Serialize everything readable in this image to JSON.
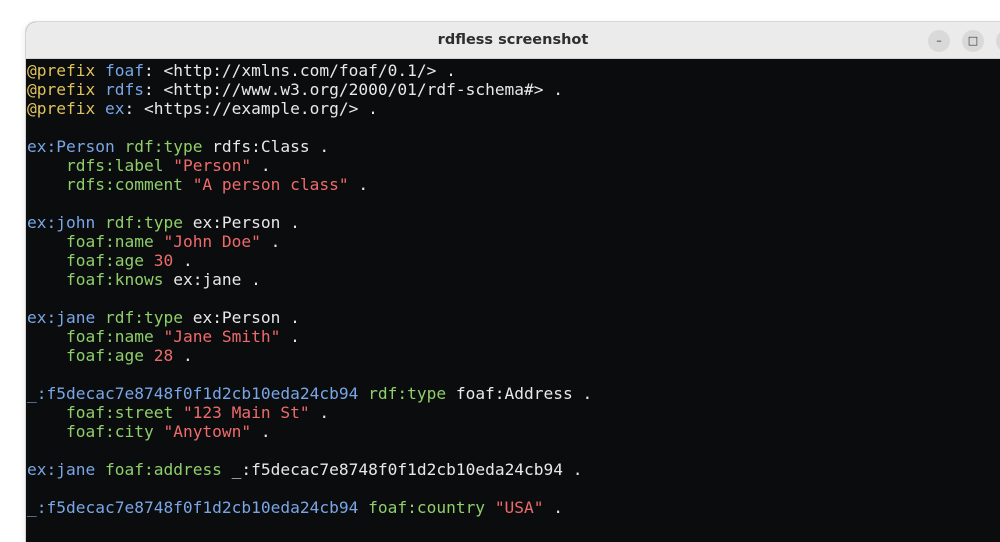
{
  "window": {
    "title": "rdfless screenshot",
    "minimize_symbol": "–",
    "maximize_symbol": "□",
    "close_symbol": "×"
  },
  "colors": {
    "prefix_keyword": "#e0c35c",
    "subject": "#79a6e6",
    "predicate": "#8fcf6a",
    "literal": "#ef6b6b",
    "plain": "#e8e8e8",
    "background": "#0b0c0e"
  },
  "lines": [
    [
      {
        "t": "@prefix",
        "c": "prefix"
      },
      {
        "t": " foaf",
        "c": "ns"
      },
      {
        "t": ": <http://xmlns.com/foaf/0.1/> .",
        "c": "plain"
      }
    ],
    [
      {
        "t": "@prefix",
        "c": "prefix"
      },
      {
        "t": " rdfs",
        "c": "ns"
      },
      {
        "t": ": <http://www.w3.org/2000/01/rdf-schema#> .",
        "c": "plain"
      }
    ],
    [
      {
        "t": "@prefix",
        "c": "prefix"
      },
      {
        "t": " ex",
        "c": "ns"
      },
      {
        "t": ": <https://example.org/> .",
        "c": "plain"
      }
    ],
    [],
    [
      {
        "t": "ex:Person",
        "c": "ns"
      },
      {
        "t": " ",
        "c": "plain"
      },
      {
        "t": "rdf:type",
        "c": "pred"
      },
      {
        "t": " rdfs:Class .",
        "c": "plain"
      }
    ],
    [
      {
        "t": "    ",
        "c": "plain"
      },
      {
        "t": "rdfs:label",
        "c": "pred"
      },
      {
        "t": " ",
        "c": "plain"
      },
      {
        "t": "\"Person\"",
        "c": "lit"
      },
      {
        "t": " .",
        "c": "plain"
      }
    ],
    [
      {
        "t": "    ",
        "c": "plain"
      },
      {
        "t": "rdfs:comment",
        "c": "pred"
      },
      {
        "t": " ",
        "c": "plain"
      },
      {
        "t": "\"A person class\"",
        "c": "lit"
      },
      {
        "t": " .",
        "c": "plain"
      }
    ],
    [],
    [
      {
        "t": "ex:john",
        "c": "ns"
      },
      {
        "t": " ",
        "c": "plain"
      },
      {
        "t": "rdf:type",
        "c": "pred"
      },
      {
        "t": " ex:Person .",
        "c": "plain"
      }
    ],
    [
      {
        "t": "    ",
        "c": "plain"
      },
      {
        "t": "foaf:name",
        "c": "pred"
      },
      {
        "t": " ",
        "c": "plain"
      },
      {
        "t": "\"John Doe\"",
        "c": "lit"
      },
      {
        "t": " .",
        "c": "plain"
      }
    ],
    [
      {
        "t": "    ",
        "c": "plain"
      },
      {
        "t": "foaf:age",
        "c": "pred"
      },
      {
        "t": " ",
        "c": "plain"
      },
      {
        "t": "30",
        "c": "lit"
      },
      {
        "t": " .",
        "c": "plain"
      }
    ],
    [
      {
        "t": "    ",
        "c": "plain"
      },
      {
        "t": "foaf:knows",
        "c": "pred"
      },
      {
        "t": " ex:jane .",
        "c": "plain"
      }
    ],
    [],
    [
      {
        "t": "ex:jane",
        "c": "ns"
      },
      {
        "t": " ",
        "c": "plain"
      },
      {
        "t": "rdf:type",
        "c": "pred"
      },
      {
        "t": " ex:Person .",
        "c": "plain"
      }
    ],
    [
      {
        "t": "    ",
        "c": "plain"
      },
      {
        "t": "foaf:name",
        "c": "pred"
      },
      {
        "t": " ",
        "c": "plain"
      },
      {
        "t": "\"Jane Smith\"",
        "c": "lit"
      },
      {
        "t": " .",
        "c": "plain"
      }
    ],
    [
      {
        "t": "    ",
        "c": "plain"
      },
      {
        "t": "foaf:age",
        "c": "pred"
      },
      {
        "t": " ",
        "c": "plain"
      },
      {
        "t": "28",
        "c": "lit"
      },
      {
        "t": " .",
        "c": "plain"
      }
    ],
    [],
    [
      {
        "t": "_:f5decac7e8748f0f1d2cb10eda24cb94",
        "c": "ns"
      },
      {
        "t": " ",
        "c": "plain"
      },
      {
        "t": "rdf:type",
        "c": "pred"
      },
      {
        "t": " foaf:Address .",
        "c": "plain"
      }
    ],
    [
      {
        "t": "    ",
        "c": "plain"
      },
      {
        "t": "foaf:street",
        "c": "pred"
      },
      {
        "t": " ",
        "c": "plain"
      },
      {
        "t": "\"123 Main St\"",
        "c": "lit"
      },
      {
        "t": " .",
        "c": "plain"
      }
    ],
    [
      {
        "t": "    ",
        "c": "plain"
      },
      {
        "t": "foaf:city",
        "c": "pred"
      },
      {
        "t": " ",
        "c": "plain"
      },
      {
        "t": "\"Anytown\"",
        "c": "lit"
      },
      {
        "t": " .",
        "c": "plain"
      }
    ],
    [],
    [
      {
        "t": "ex:jane",
        "c": "ns"
      },
      {
        "t": " ",
        "c": "plain"
      },
      {
        "t": "foaf:address",
        "c": "pred"
      },
      {
        "t": " _:f5decac7e8748f0f1d2cb10eda24cb94 .",
        "c": "plain"
      }
    ],
    [],
    [
      {
        "t": "_:f5decac7e8748f0f1d2cb10eda24cb94",
        "c": "ns"
      },
      {
        "t": " ",
        "c": "plain"
      },
      {
        "t": "foaf:country",
        "c": "pred"
      },
      {
        "t": " ",
        "c": "plain"
      },
      {
        "t": "\"USA\"",
        "c": "lit"
      },
      {
        "t": " .",
        "c": "plain"
      }
    ]
  ]
}
